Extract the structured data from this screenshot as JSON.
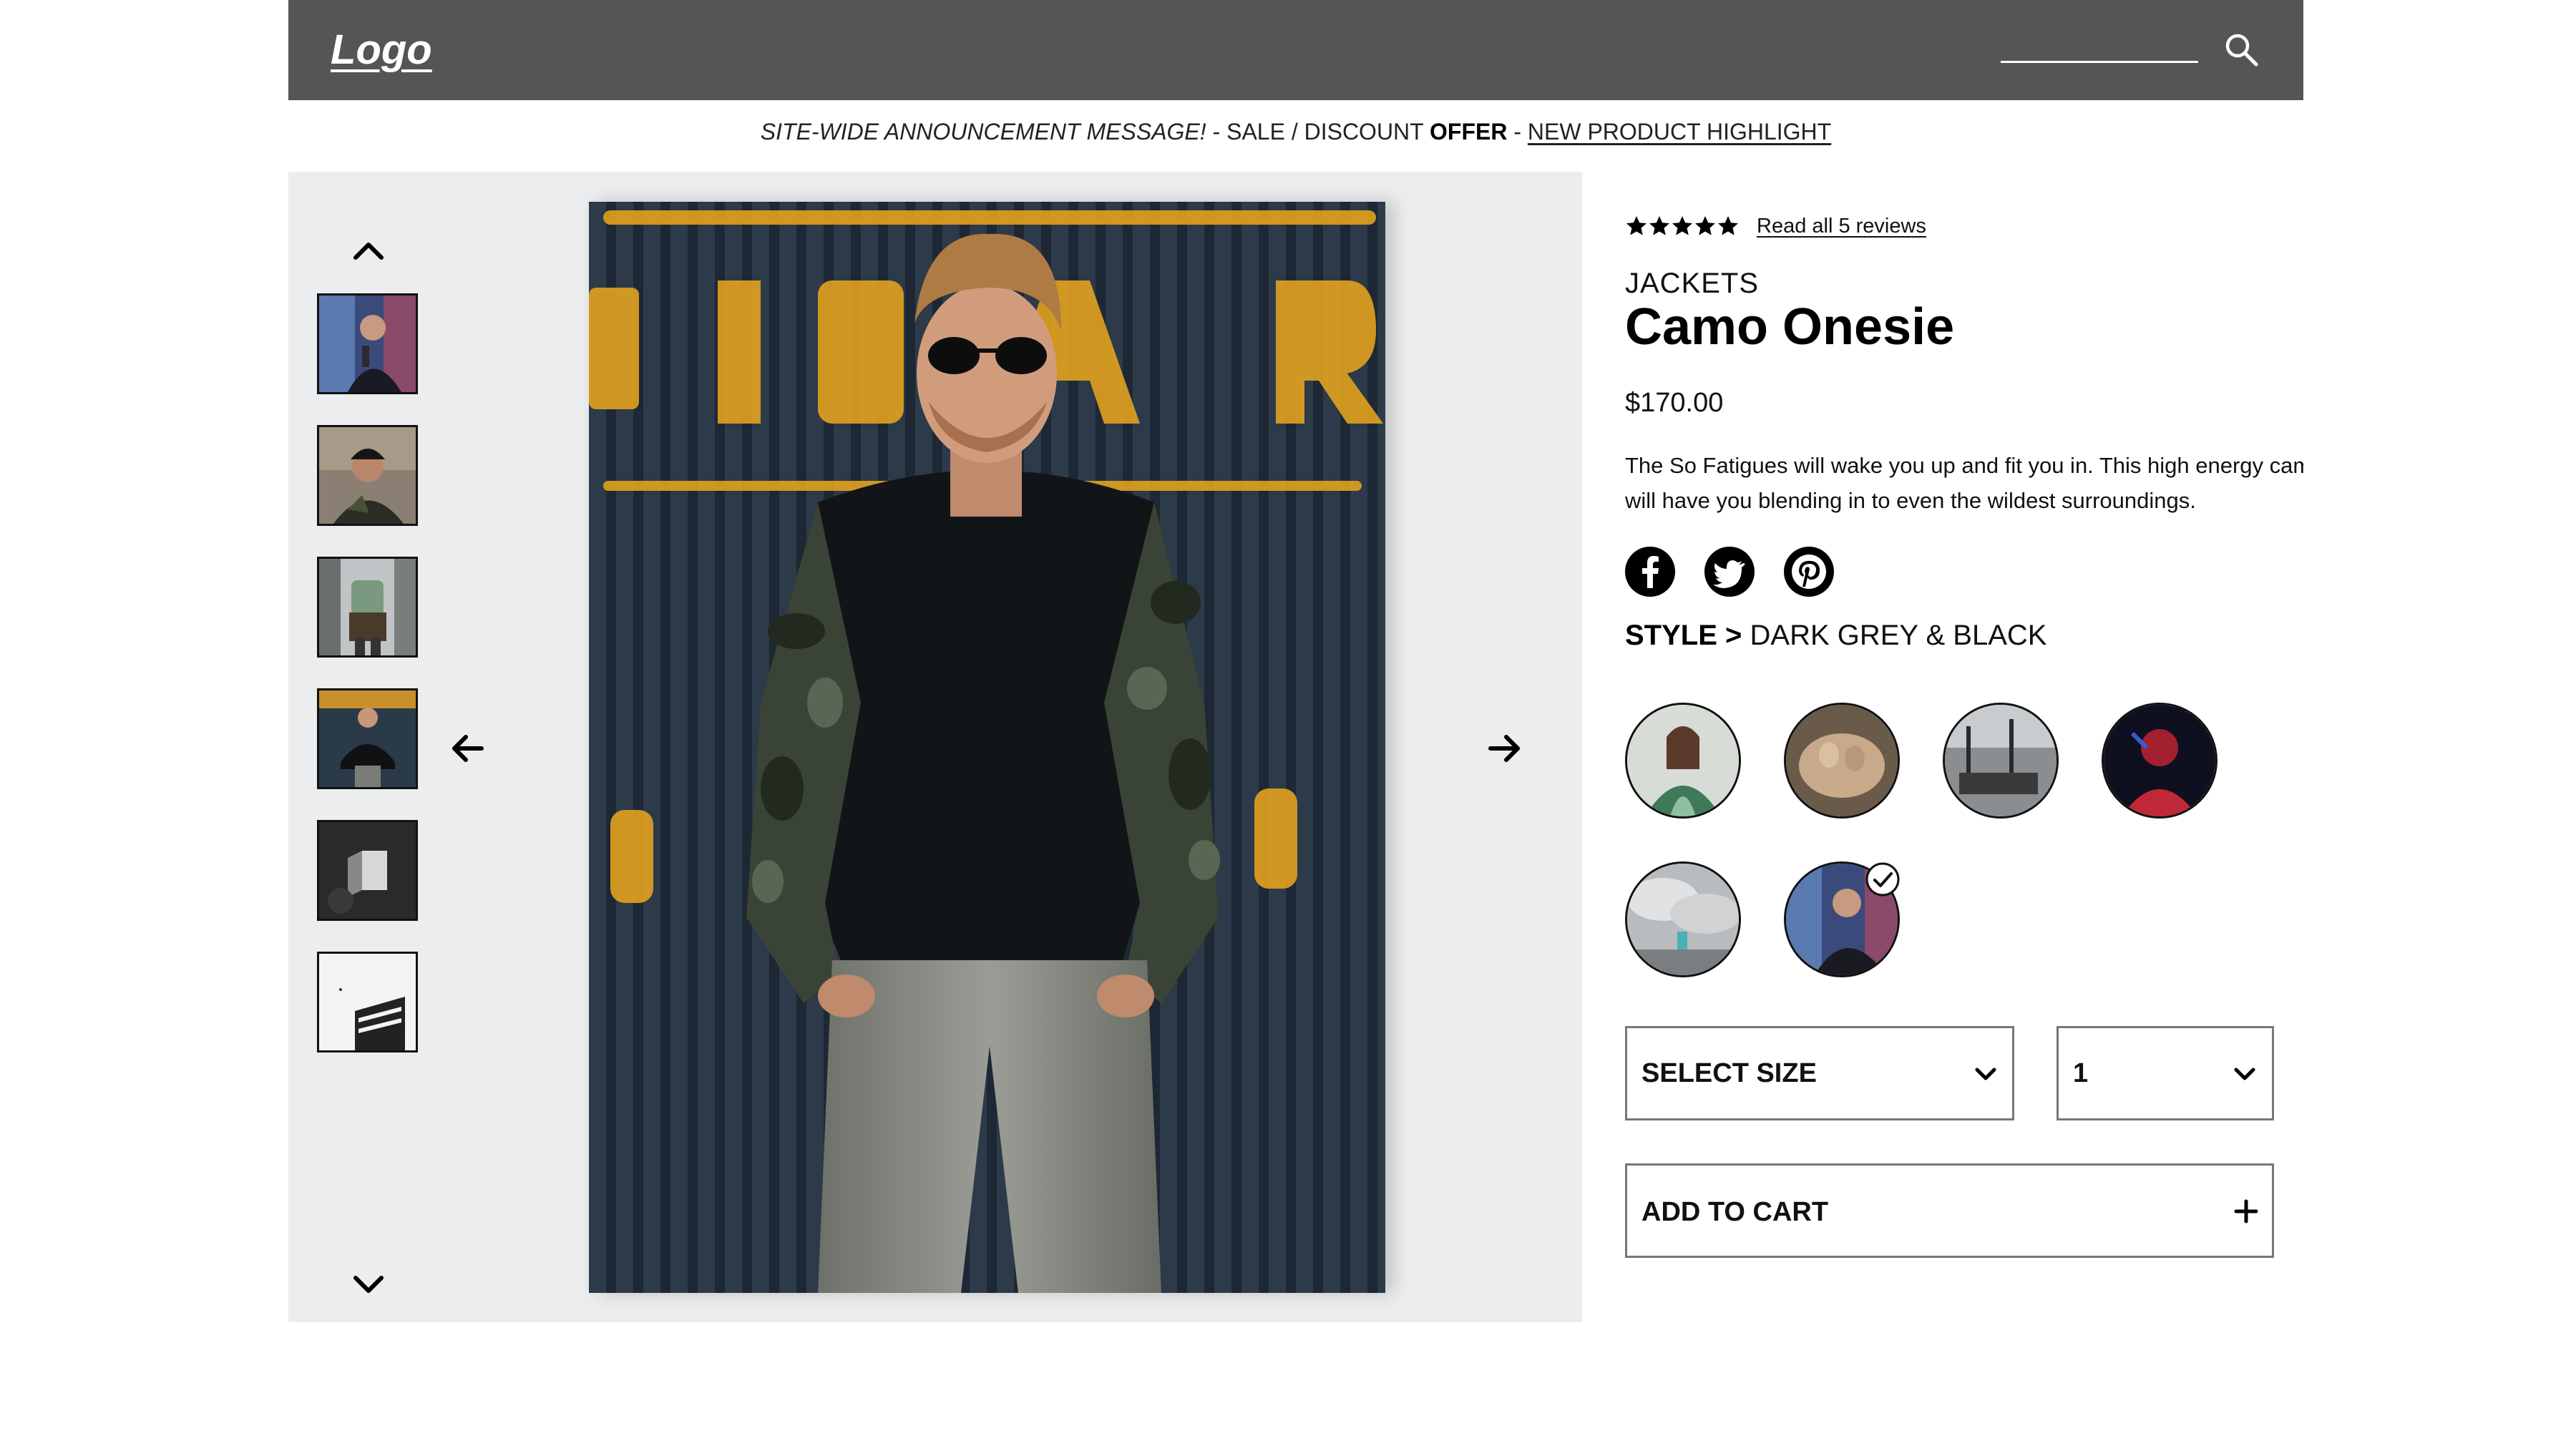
{
  "header": {
    "logo": "Logo",
    "search_placeholder": ""
  },
  "announcement": {
    "part1": "SITE-WIDE ANNOUNCEMENT MESSAGE!",
    "part2": " - SALE / DISCOUNT ",
    "part3": "OFFER",
    "part4": " - ",
    "link": "NEW PRODUCT HIGHLIGHT"
  },
  "gallery": {
    "thumbnails": [
      {
        "icon": "graffiti-portrait-thumb"
      },
      {
        "icon": "beanie-portrait-thumb"
      },
      {
        "icon": "backpack-street-thumb"
      },
      {
        "icon": "camo-sweater-thumb",
        "selected": true
      },
      {
        "icon": "dark-room-thumb"
      },
      {
        "icon": "building-bw-thumb"
      }
    ],
    "selected_index": 3
  },
  "product": {
    "rating": 5,
    "reviews_link": "Read all 5 reviews",
    "category": "JACKETS",
    "title": "Camo Onesie",
    "price": "$170.00",
    "description_line1": "The So Fatigues will wake you up and fit you in. This high energy camo",
    "description_line2": "will have you blending in to even the wildest surroundings.",
    "social": [
      "facebook-icon",
      "twitter-icon",
      "pinterest-icon"
    ],
    "style_label": "STYLE >",
    "style_value": " DARK GREY & BLACK",
    "swatches_count": 6,
    "selected_swatch": 5,
    "size_label": "SELECT SIZE",
    "qty_value": "1",
    "add_to_cart": "ADD TO CART"
  },
  "colors": {
    "header_bg": "#555555",
    "gallery_bg": "#ecedef",
    "border": "#777777"
  }
}
